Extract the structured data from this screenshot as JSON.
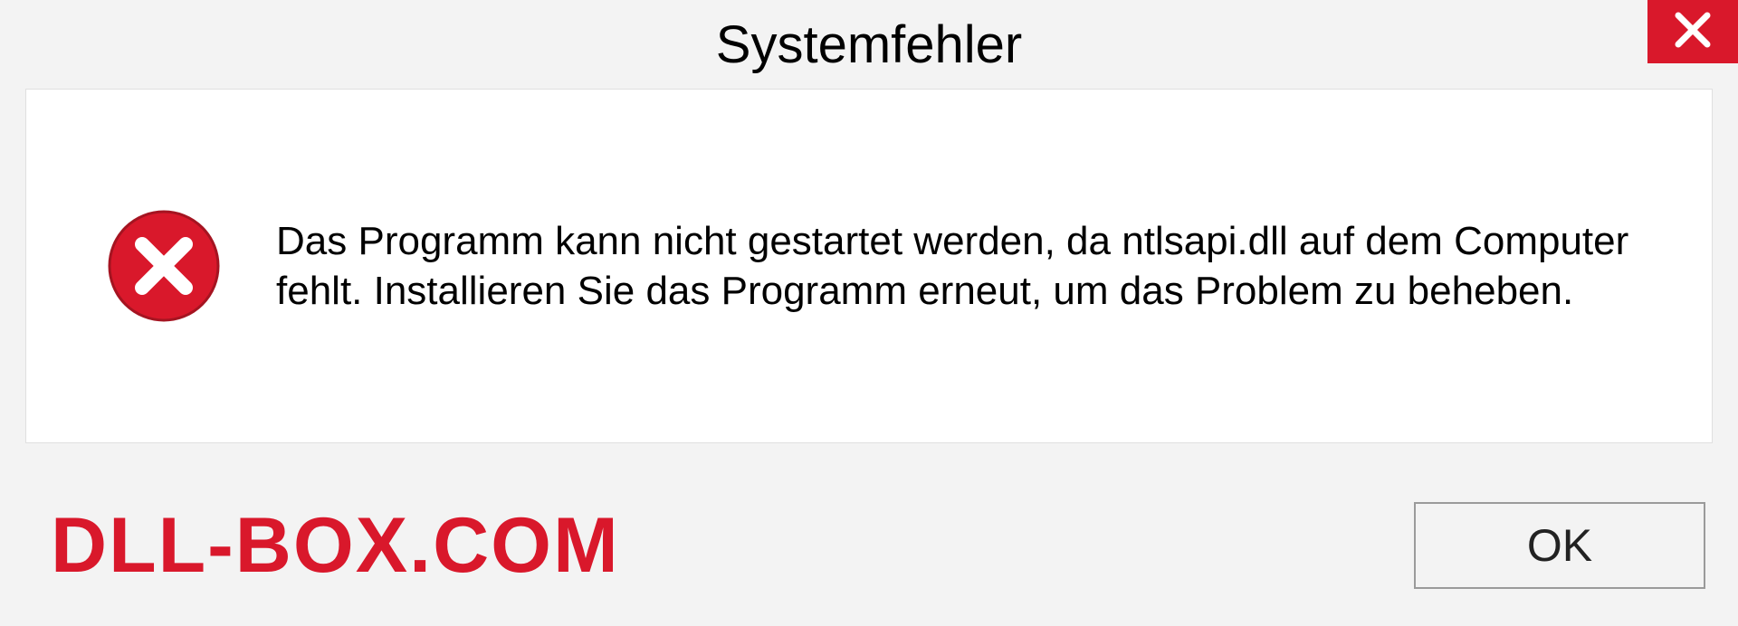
{
  "dialog": {
    "title": "Systemfehler",
    "message": "Das Programm kann nicht gestartet werden, da ntlsapi.dll auf dem Computer fehlt. Installieren Sie das Programm erneut, um das Problem zu beheben.",
    "ok_label": "OK"
  },
  "brand": "DLL-BOX.COM",
  "colors": {
    "accent_red": "#d9182b"
  }
}
